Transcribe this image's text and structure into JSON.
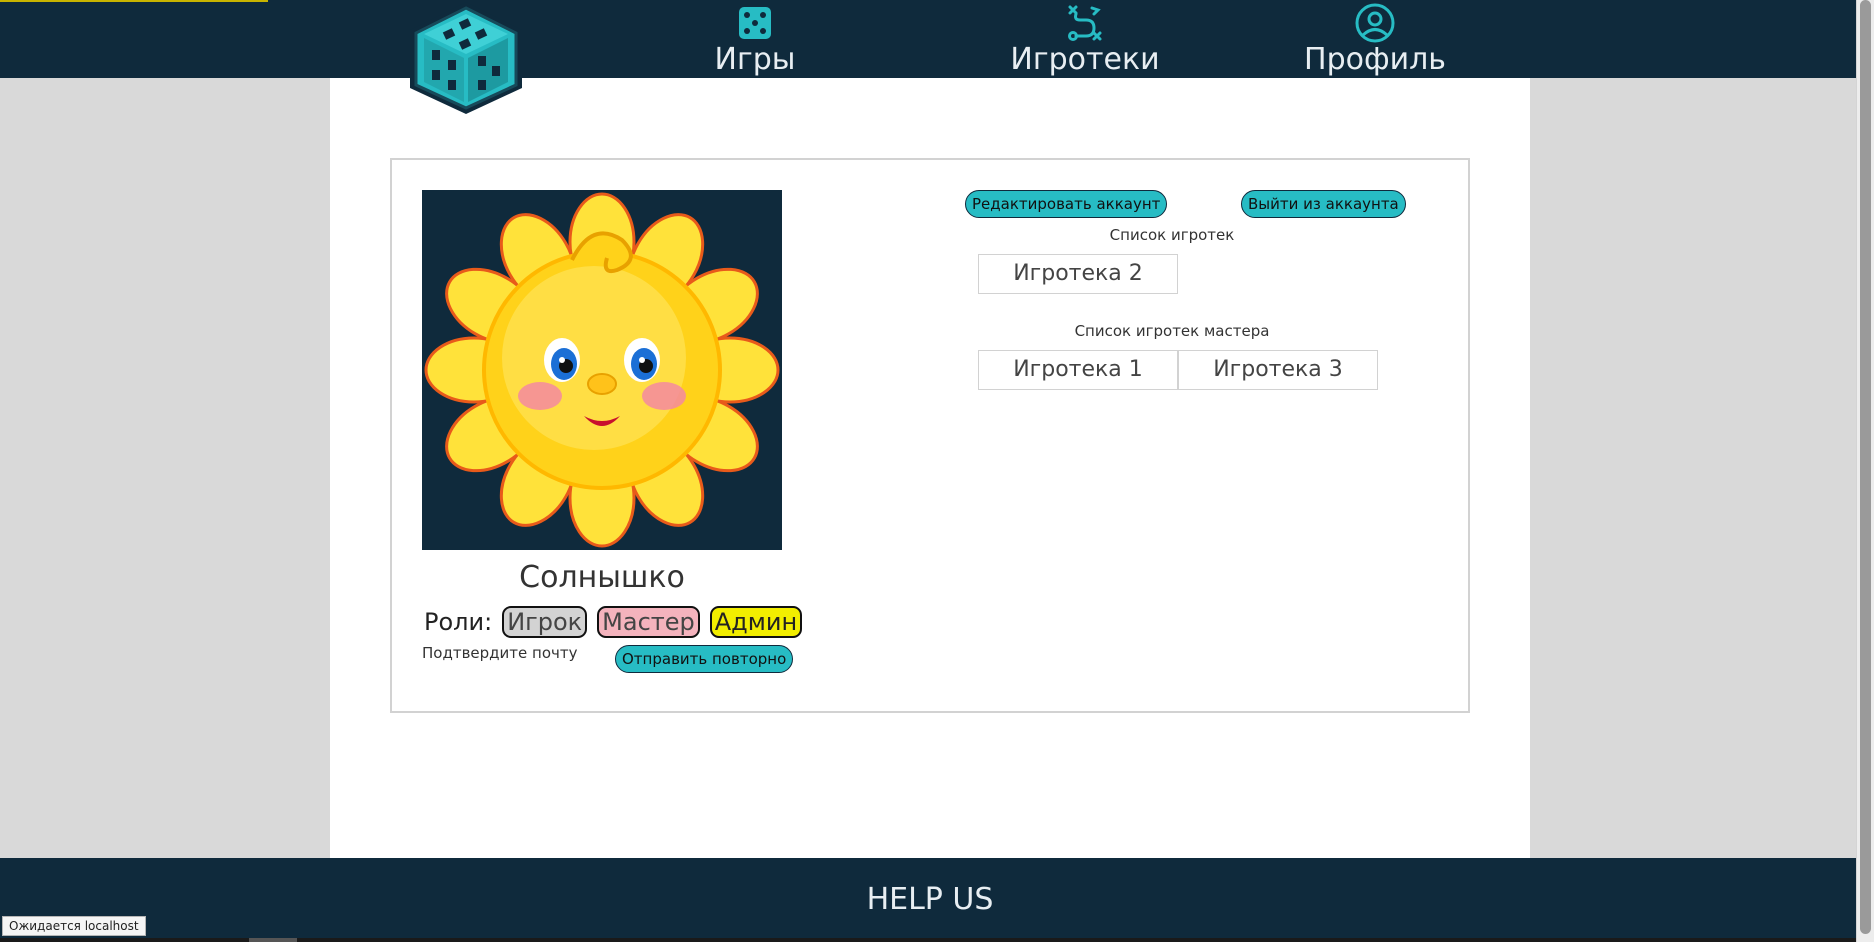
{
  "header": {
    "nav": [
      {
        "label": "Игры",
        "icon": "dice-icon"
      },
      {
        "label": "Игротеки",
        "icon": "route-icon"
      },
      {
        "label": "Профиль",
        "icon": "user-circle-icon"
      }
    ]
  },
  "profile": {
    "username": "Солнышко",
    "roles_label": "Роли:",
    "roles": [
      "Игрок",
      "Мастер",
      "Админ"
    ],
    "confirm_text": "Подтвердите почту",
    "resend_label": "Отправить повторно",
    "edit_label": "Редактировать аккаунт",
    "logout_label": "Выйти из аккаунта"
  },
  "lists": {
    "libraries_title": "Список игротек",
    "libraries": [
      "Игротека 2"
    ],
    "master_title": "Список игротек мастера",
    "master_libraries": [
      "Игротека 1",
      "Игротека 3"
    ]
  },
  "footer": {
    "help": "HELP US"
  },
  "status": {
    "tooltip": "Ожидается localhost"
  },
  "colors": {
    "header_bg": "#0f2a3c",
    "accent": "#27bcc4",
    "role_player": "#d3d3d3",
    "role_master": "#f4b3bd",
    "role_admin": "#f2ee00"
  }
}
